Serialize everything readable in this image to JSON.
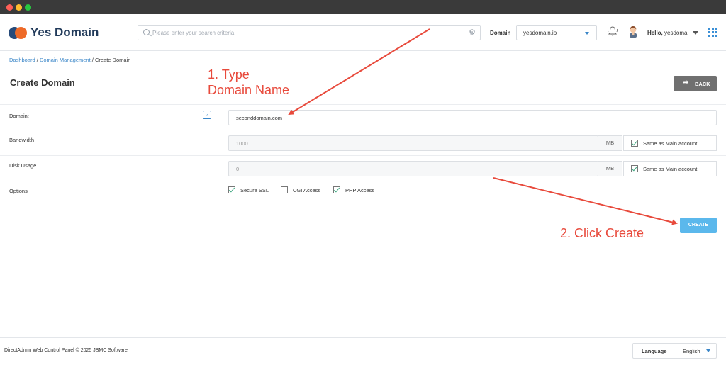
{
  "header": {
    "brand": "Yes Domain",
    "search_placeholder": "Please enter your search criteria",
    "domain_label": "Domain",
    "domain_value": "yesdomain.io",
    "greeting_prefix": "Hello,",
    "greeting_user": "yesdomai"
  },
  "breadcrumb": {
    "item1": "Dashboard",
    "sep1": " / ",
    "item2": "Domain Management",
    "sep2": " / ",
    "item3": "Create Domain"
  },
  "page": {
    "title": "Create Domain",
    "back_label": "BACK",
    "create_label": "CREATE"
  },
  "form": {
    "domain_label": "Domain:",
    "domain_help": "?",
    "domain_value": "seconddomain.com",
    "bandwidth_label": "Bandwidth",
    "bandwidth_value": "1000",
    "bandwidth_unit": "MB",
    "bandwidth_same": "Same as Main account",
    "disk_label": "Disk Usage",
    "disk_value": "0",
    "disk_unit": "MB",
    "disk_same": "Same as Main account",
    "options_label": "Options",
    "options": [
      {
        "label": "Secure SSL",
        "checked": true
      },
      {
        "label": "CGI Access",
        "checked": false
      },
      {
        "label": "PHP Access",
        "checked": true
      }
    ]
  },
  "annotations": {
    "step1_line1": "1. Type",
    "step1_line2": "Domain Name",
    "step2": "2. Click Create",
    "color": "#e84a3c"
  },
  "footer": {
    "copyright": "DirectAdmin Web Control Panel © 2025 JBMC Software",
    "language_label": "Language",
    "language_value": "English"
  },
  "colors": {
    "accent": "#3a86c8",
    "create_button": "#5bb8ec",
    "back_button": "#707070"
  }
}
